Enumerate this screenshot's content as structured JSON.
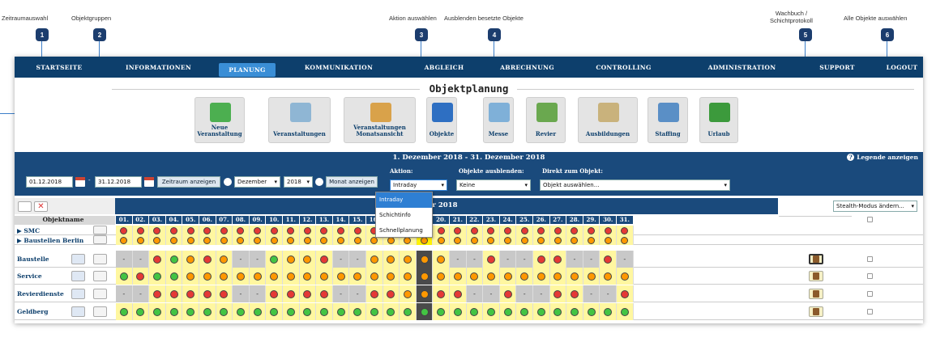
{
  "annotations": [
    {
      "num": "1",
      "label": "Zeitraumauswahl"
    },
    {
      "num": "2",
      "label": "Objektgruppen"
    },
    {
      "num": "3",
      "label": "Aktion auswählen"
    },
    {
      "num": "4",
      "label": "Ausblenden besetzte Objekte"
    },
    {
      "num": "5",
      "label": "Wachbuch /\nSchichtprotokoll"
    },
    {
      "num": "6",
      "label": "Alle Objekte auswählen"
    }
  ],
  "nav": [
    "STARTSEITE",
    "INFORMATIONEN",
    "PLANUNG",
    "KOMMUNIKATION",
    "ABGLEICH",
    "ABRECHNUNG",
    "CONTROLLING",
    "ADMINISTRATION",
    "SUPPORT",
    "LOGOUT"
  ],
  "nav_active": "PLANUNG",
  "page_title": "Objektplanung",
  "tiles": [
    {
      "label": "Neue\nVeranstaltung",
      "icon": "plus-icon",
      "color": "#4caf50"
    },
    {
      "label": "Veranstaltungen",
      "icon": "blueprint-icon",
      "color": "#8fb6d4"
    },
    {
      "label": "Veranstaltungen\nMonatsansicht",
      "icon": "calendar-icon",
      "color": "#d9a24a"
    },
    {
      "label": "Objekte",
      "icon": "cube-icon",
      "color": "#2e6fc2"
    },
    {
      "label": "Messe",
      "icon": "grid-icon",
      "color": "#7fb0d8"
    },
    {
      "label": "Revier",
      "icon": "map-icon",
      "color": "#6aa84f"
    },
    {
      "label": "Ausbildungen",
      "icon": "certificate-icon",
      "color": "#c9b27c"
    },
    {
      "label": "Staffing",
      "icon": "monitor-icon",
      "color": "#5a8fc6"
    },
    {
      "label": "Urlaub",
      "icon": "palm-icon",
      "color": "#3c9a3c"
    }
  ],
  "band": {
    "date_range": "1. Dezember 2018 - 31. Dezember 2018",
    "legend": "Legende anzeigen"
  },
  "filters": {
    "from": "01.12.2018",
    "to": "31.12.2018",
    "show_period": "Zeitraum anzeigen",
    "month": "Dezember",
    "year": "2018",
    "show_month": "Monat anzeigen",
    "action_label": "Aktion:",
    "action_value": "Intraday",
    "hide_label": "Objekte ausblenden:",
    "hide_value": "Keine",
    "direct_label": "Direkt zum Objekt:",
    "direct_value": "Objekt auswählen..."
  },
  "dropdown_options": [
    "Intraday",
    "Schichtinfo",
    "Schnellplanung"
  ],
  "grid": {
    "month_label": "er 2018",
    "name_header": "Objektname",
    "stealth": "Stealth-Modus ändern...",
    "days": [
      "01.",
      "02.",
      "03.",
      "04.",
      "05.",
      "06.",
      "07.",
      "08.",
      "09.",
      "10.",
      "11.",
      "12.",
      "13.",
      "14.",
      "15.",
      "16.",
      "17.",
      "18.",
      "19.",
      "20.",
      "21.",
      "22.",
      "23.",
      "24.",
      "25.",
      "26.",
      "27.",
      "28.",
      "29.",
      "30.",
      "31."
    ],
    "rows": [
      {
        "name": "▶ SMC",
        "cells": "RRRRRRRRRRRRRRRRRRRRRRRRRRRRRRR",
        "type": "group"
      },
      {
        "name": "▶ Baustellen Berlin",
        "cells": "OOOOOOOOOOOOOOOOOOOOOOOOOOOOOOO",
        "type": "group"
      },
      {
        "name": "Baustelle",
        "cells": "--RGORO--GOOR--OOOOO--R--RR--R",
        "type": "row"
      },
      {
        "name": "Service",
        "cells": "GRGGOOOOOOOOOOOOOOOOOOOOOOOOOOO",
        "type": "row"
      },
      {
        "name": "Revierdienste",
        "cells": "--RRRRR--RRRR--RROORR--R--RR--R",
        "type": "row"
      },
      {
        "name": "Geldberg",
        "cells": "GGGGGGGGGGGGGGGGGGGGGGGGGGGGGGG",
        "type": "row"
      }
    ]
  },
  "colors": {
    "nav": "#0d3f6c",
    "band": "#1a4a7c",
    "active": "#3a8ed6",
    "red": "#e53935",
    "orange": "#ff9800",
    "green": "#43c443",
    "yellow": "#fff799",
    "grey": "#c8c8c8",
    "today": "#2e7fd3"
  }
}
